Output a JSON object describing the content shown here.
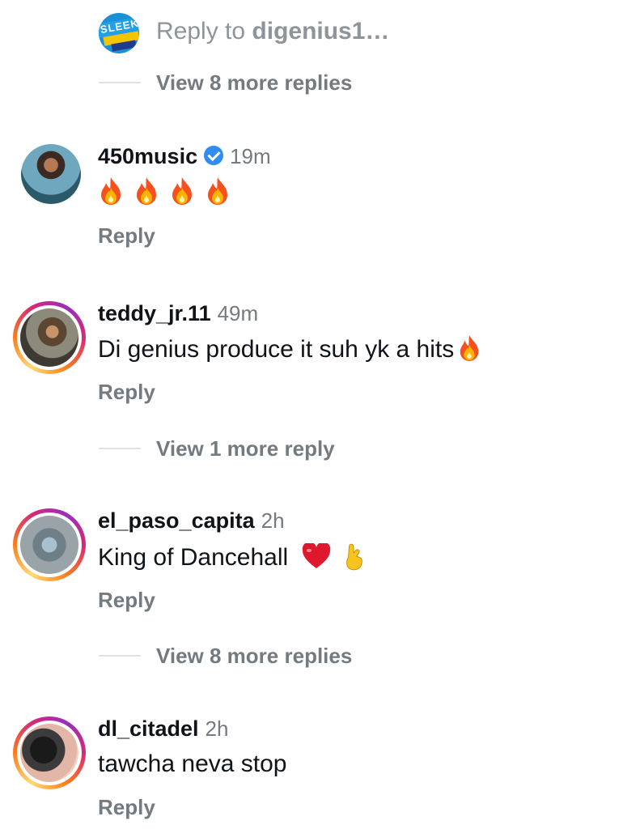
{
  "reply_to": {
    "label": "Reply to",
    "target": "digenius1…",
    "avatar_text": "SLEEK"
  },
  "view_more_1": "View 8 more replies",
  "comments": [
    {
      "username": "450music",
      "verified": true,
      "time": "19m",
      "text": "🔥🔥🔥🔥",
      "reply": "Reply"
    },
    {
      "username": "teddy_jr.11",
      "verified": false,
      "time": "49m",
      "text": "Di genius produce it suh yk a hits",
      "reply": "Reply",
      "view_more": "View 1 more reply"
    },
    {
      "username": "el_paso_capita",
      "verified": false,
      "time": "2h",
      "text": "King of Dancehall",
      "reply": "Reply",
      "view_more": "View 8 more replies"
    },
    {
      "username": "dl_citadel",
      "verified": false,
      "time": "2h",
      "text": "tawcha neva stop",
      "reply": "Reply"
    }
  ],
  "colors": {
    "muted_text": "#737a80",
    "verified_blue": "#2f8cf0",
    "story_ring": "#d62976"
  }
}
